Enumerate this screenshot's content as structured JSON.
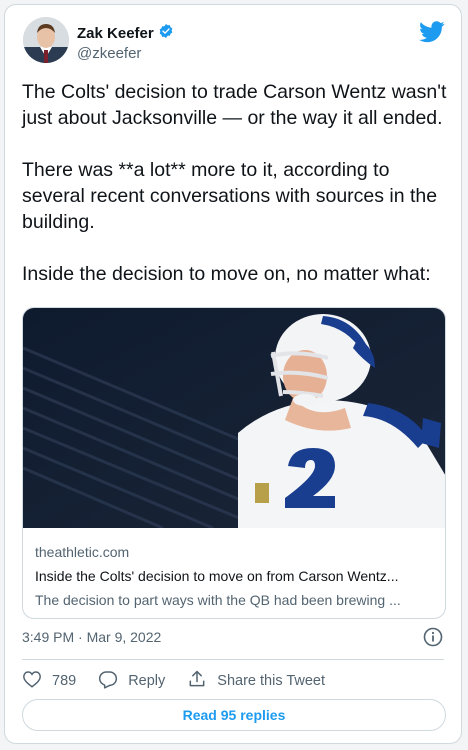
{
  "author": {
    "name": "Zak Keefer",
    "handle": "@zkeefer",
    "verified": true
  },
  "tweet": {
    "paragraphs": [
      "The Colts' decision to trade Carson Wentz wasn't just about Jacksonville — or the way it all ended.",
      "There was **a lot** more to it, according to several recent conversations with sources in the building.",
      "Inside the decision to move on, no matter what:"
    ],
    "timestamp": "3:49 PM · Mar 9, 2022"
  },
  "link_card": {
    "domain": "theathletic.com",
    "title": "Inside the Colts' decision to move on from Carson Wentz...",
    "description": "The decision to part ways with the QB had been brewing ..."
  },
  "actions": {
    "likes": "789",
    "reply_label": "Reply",
    "share_label": "Share this Tweet"
  },
  "replies_button": "Read 95 replies",
  "colors": {
    "accent": "#1d9bf0",
    "text": "#0f1419",
    "muted": "#536471",
    "border": "#cfd9de"
  }
}
